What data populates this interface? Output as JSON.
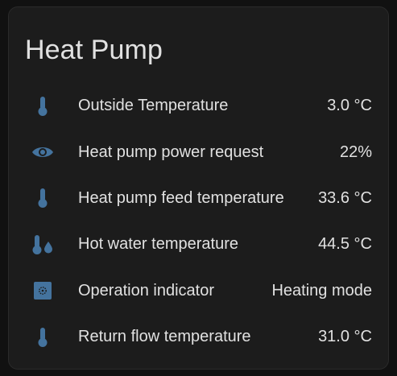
{
  "card": {
    "title": "Heat Pump",
    "accent_color": "#44739e",
    "rows": [
      {
        "icon": "thermometer-icon",
        "label": "Outside Temperature",
        "value": "3.0 °C"
      },
      {
        "icon": "eye-icon",
        "label": "Heat pump power request",
        "value": "22%"
      },
      {
        "icon": "thermometer-icon",
        "label": "Heat pump feed temperature",
        "value": "33.6 °C"
      },
      {
        "icon": "thermometer-water-icon",
        "label": "Hot water temperature",
        "value": "44.5 °C"
      },
      {
        "icon": "operation-indicator-icon",
        "label": "Operation indicator",
        "value": "Heating mode"
      },
      {
        "icon": "thermometer-icon",
        "label": "Return flow temperature",
        "value": "31.0 °C"
      }
    ]
  }
}
